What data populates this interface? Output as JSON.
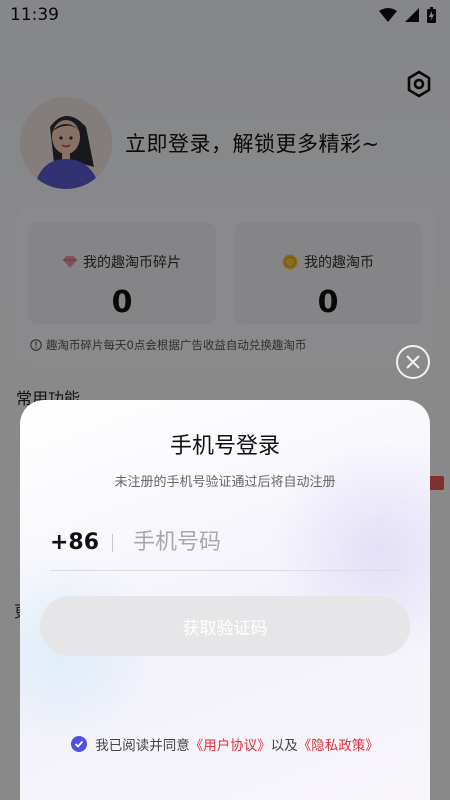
{
  "status_bar": {
    "time": "11:39"
  },
  "profile": {
    "login_prompt": "立即登录，解锁更多精彩~"
  },
  "wallet": {
    "fragments_label": "我的趣淘币碎片",
    "fragments_value": "0",
    "coins_label": "我的趣淘币",
    "coins_value": "0",
    "note": "趣淘币碎片每天0点会根据广告收益自动兑换趣淘币"
  },
  "sections": {
    "common_title": "常用功能",
    "partial_char": "更"
  },
  "login_sheet": {
    "title": "手机号登录",
    "subtitle": "未注册的手机号验证通过后将自动注册",
    "country_code": "+86",
    "phone_placeholder": "手机号码",
    "get_code_button": "获取验证码",
    "agreement_prefix": "我已阅读并同意",
    "user_agreement": "《用户协议》",
    "agreement_joiner": "以及",
    "privacy_policy": "《隐私政策》"
  },
  "colors": {
    "accent": "#4f4fe0",
    "link": "#d9313b",
    "button_disabled": "#e6e6e8"
  }
}
